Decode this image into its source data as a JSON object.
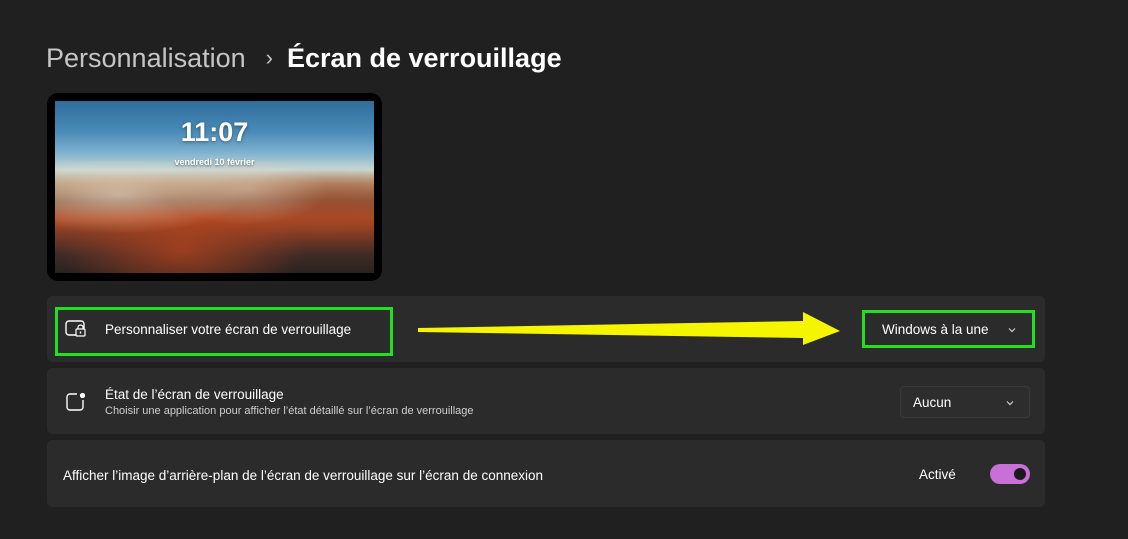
{
  "breadcrumb": {
    "parent": "Personnalisation",
    "separator": "›",
    "current": "Écran de verrouillage"
  },
  "preview": {
    "time": "11:07",
    "date": "vendredi 10 février"
  },
  "settings": {
    "personalize": {
      "label": "Personnaliser votre écran de verrouillage",
      "value": "Windows à la une",
      "icon": "lock-screen-icon"
    },
    "status": {
      "label": "État de l’écran de verrouillage",
      "description": "Choisir une application pour afficher l’état détaillé sur l’écran de verrouillage",
      "value": "Aucun",
      "icon": "app-status-icon"
    },
    "signin_background": {
      "label": "Afficher l’image d’arrière-plan de l’écran de verrouillage sur l’écran de connexion",
      "state": "Activé",
      "on": true
    }
  },
  "colors": {
    "highlight": "#22e01f",
    "arrow": "#f5f500",
    "toggle_accent": "#c86fd8",
    "background": "#202020",
    "card": "#2b2b2b"
  }
}
